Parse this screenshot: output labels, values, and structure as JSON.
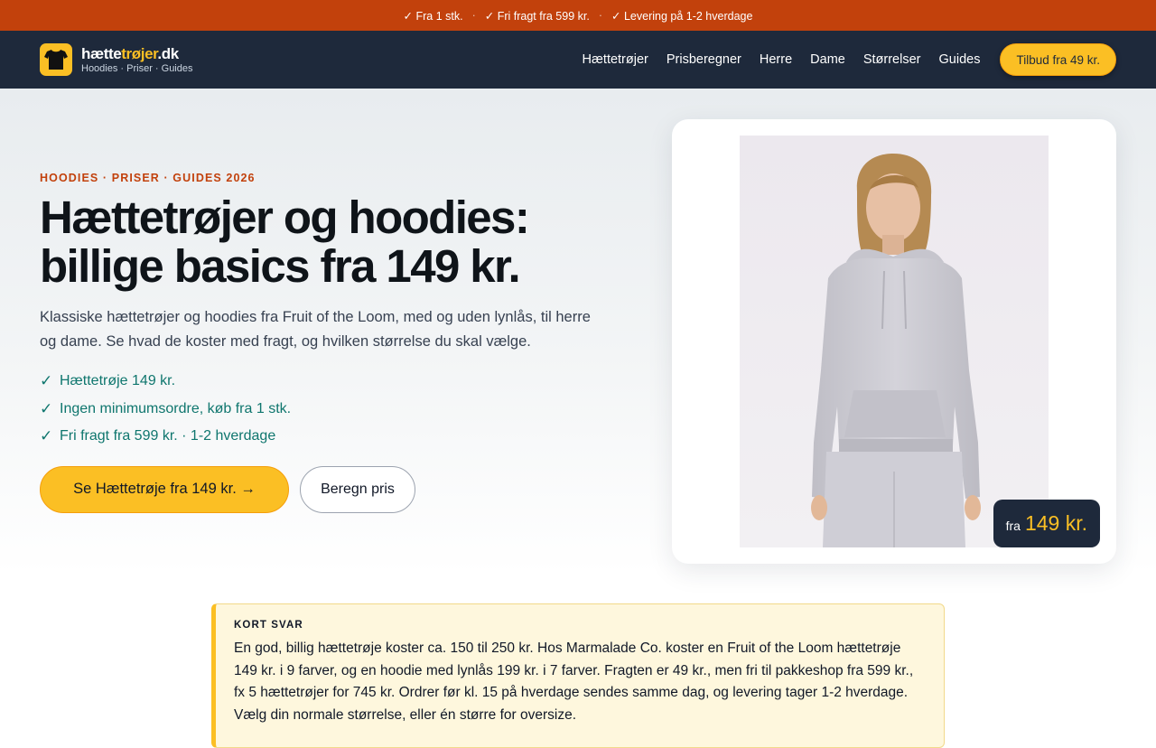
{
  "topbar": {
    "items": [
      "✓ Fra 1 stk.",
      "✓ Fri fragt fra 599 kr.",
      "✓ Levering på 1-2 hverdage"
    ],
    "separator": "·",
    "background": "#c2410c"
  },
  "header": {
    "logo": {
      "name_prefix": "hætte",
      "name_accent": "trøjer",
      "name_suffix": ".dk",
      "tagline": "Hoodies · Priser · Guides",
      "icon": "tshirt-icon"
    },
    "nav": [
      "Hættetrøjer",
      "Prisberegner",
      "Herre",
      "Dame",
      "Størrelser",
      "Guides"
    ],
    "cta_label": "Tilbud fra 49 kr."
  },
  "hero": {
    "eyebrow": "HOODIES · PRISER · GUIDES 2026",
    "title": "Hættetrøjer og hoodies: billige basics fra 149 kr.",
    "lede": "Klassiske hættetrøjer og hoodies fra Fruit of the Loom, med og uden lynlås, til herre og dame. Se hvad de koster med fragt, og hvilken størrelse du skal vælge.",
    "checks": [
      "Hættetrøje 149 kr.",
      "Ingen minimumsordre, køb fra 1 stk.",
      "Fri fragt fra 599 kr. · 1-2 hverdage"
    ],
    "check_mark": "✓",
    "primary_button": "Se Hættetrøje fra 149 kr. →",
    "secondary_button": "Beregn pris",
    "price_badge": {
      "prefix": "fra",
      "amount": "149 kr."
    }
  },
  "short_answer": {
    "label": "KORT SVAR",
    "text": "En god, billig hættetrøje koster ca. 150 til 250 kr. Hos Marmalade Co. koster en Fruit of the Loom hættetrøje 149 kr. i 9 farver, og en hoodie med lynlås 199 kr. i 7 farver. Fragten er 49 kr., men fri til pakkeshop fra 599 kr., fx 5 hættetrøjer for 745 kr. Ordrer før kl. 15 på hverdage sendes samme dag, og levering tager 1-2 hverdage. Vælg din normale størrelse, eller én større for oversize."
  },
  "colors": {
    "accent": "#fbbf24",
    "brand_orange": "#c2410c",
    "navy": "#1e293b",
    "success_green": "#0f766e"
  }
}
